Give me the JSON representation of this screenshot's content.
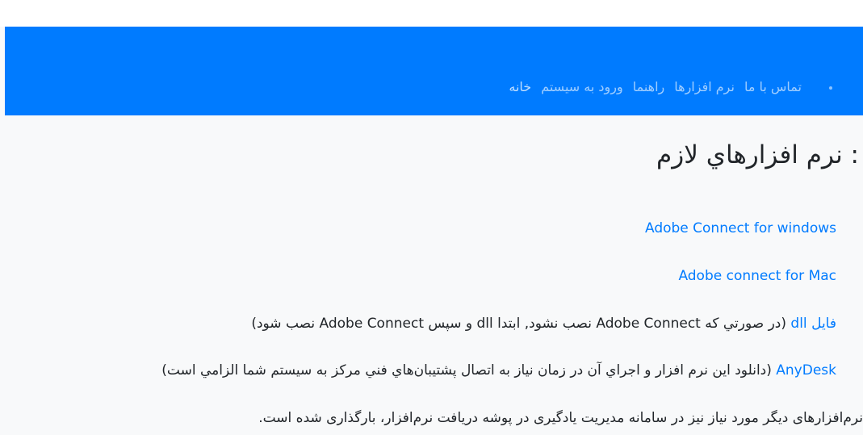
{
  "navbar": {
    "items": [
      {
        "label": "خانه"
      },
      {
        "label": "ورود به سيستم"
      },
      {
        "label": "راهنما"
      },
      {
        "label": "نرم افزارها"
      },
      {
        "label": "تماس با ما"
      }
    ],
    "bg_color": "#007bff"
  },
  "main": {
    "heading": ": نرم افزارهاي لازم",
    "links": {
      "windows": "Adobe Connect for windows",
      "mac": "Adobe connect for Mac",
      "dll": "فايل dll",
      "anydesk": "AnyDesk"
    },
    "dll_note": "(در صورتي که Adobe Connect نصب نشود, ابتدا dll و سپس Adobe Connect نصب شود)",
    "anydesk_note": "(دانلود اين نرم افزار و اجراي آن در زمان نياز به اتصال پشتيبان‌هاي فني مرکز به سيستم شما الزامي است)",
    "footer_note": "نرم‌افزارهای دیگر مورد نیاز نیز در سامانه مدیریت یادگیری در پوشه دریافت نرم‌افزار، بارگذاری شده است."
  },
  "colors": {
    "link": "#007bff",
    "text": "#212529",
    "background": "#f8f9fa"
  }
}
